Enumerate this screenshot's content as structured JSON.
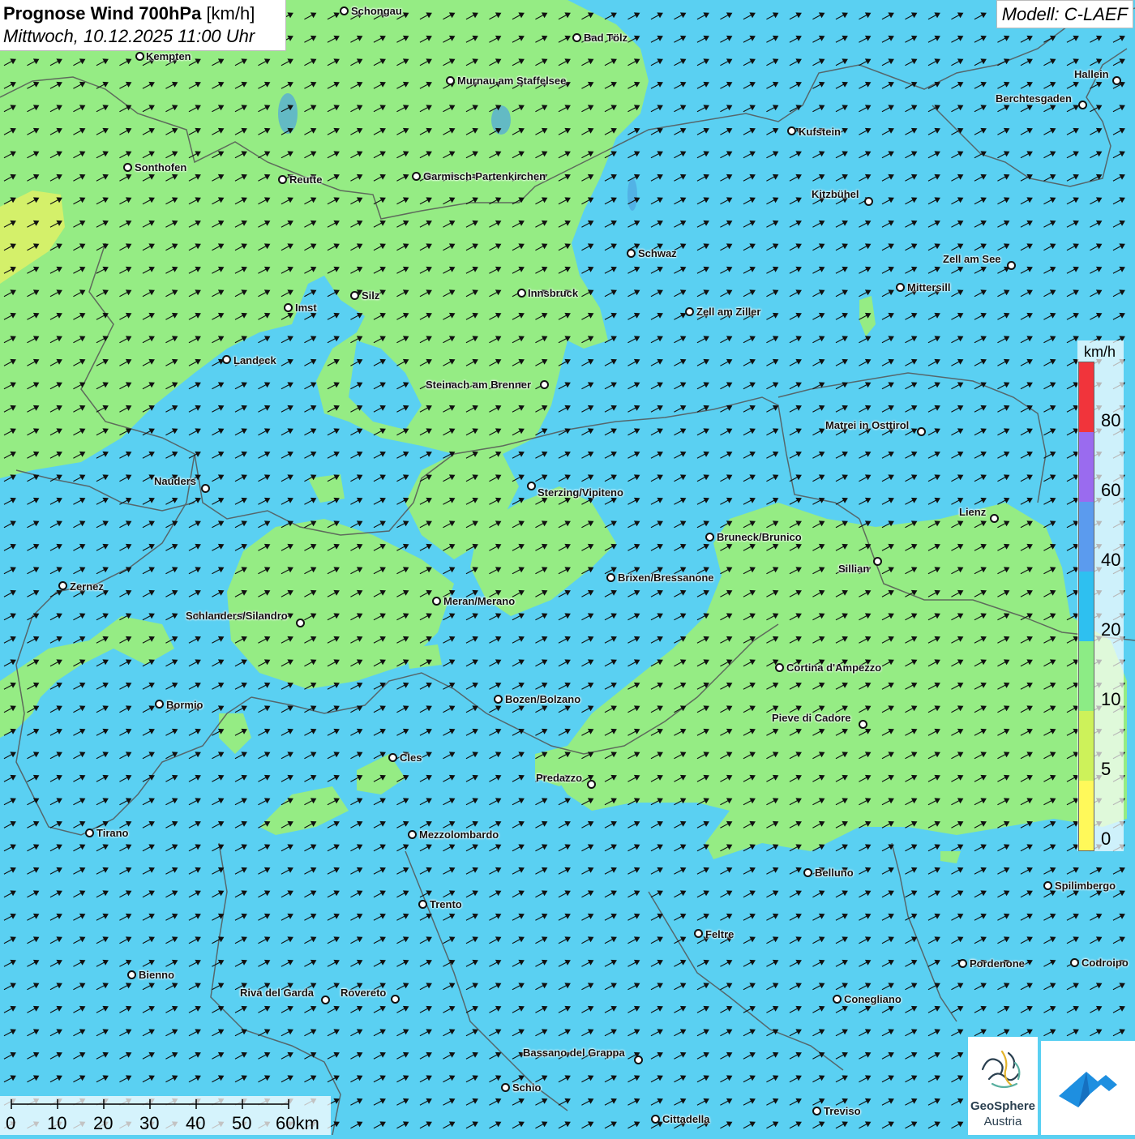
{
  "header": {
    "title_bold": "Prognose Wind 700hPa",
    "title_unit": "[km/h]",
    "subtitle": "Mittwoch, 10.12.2025 11:00 Uhr"
  },
  "model_label": "Modell: C-LAEF",
  "legend": {
    "unit": "km/h",
    "labels": [
      "80",
      "60",
      "40",
      "20",
      "10",
      "5",
      "0"
    ],
    "colors": {
      "0-5": "#fff95a",
      "5-10": "#cdf25a",
      "10-20": "#8cec85",
      "20-40": "#2ec0f0",
      "40-60": "#5b9bee",
      "60-80": "#9a6bef",
      "80+": "#f1343b"
    }
  },
  "map_colors": {
    "fill_light_blue": "#5ad0f2",
    "fill_green": "#95ec84",
    "fill_yellowgreen": "#d4f06a",
    "border": "#555555",
    "arrow": "#111111"
  },
  "wind_direction": "north-east",
  "scalebar": {
    "labels": [
      "0",
      "10",
      "20",
      "30",
      "40",
      "50",
      "60km"
    ]
  },
  "cities": [
    {
      "name": "Schongau"
    },
    {
      "name": "Bad Tölz"
    },
    {
      "name": "Kempten"
    },
    {
      "name": "Murnau am Staffelsee"
    },
    {
      "name": "Hallein"
    },
    {
      "name": "Berchtesgaden"
    },
    {
      "name": "Kufstein"
    },
    {
      "name": "Sonthofen"
    },
    {
      "name": "Reutte"
    },
    {
      "name": "Garmisch-Partenkirchen"
    },
    {
      "name": "Kitzbühel"
    },
    {
      "name": "Schwaz"
    },
    {
      "name": "Zell am See"
    },
    {
      "name": "Mittersill"
    },
    {
      "name": "Innsbruck"
    },
    {
      "name": "Silz"
    },
    {
      "name": "Imst"
    },
    {
      "name": "Zell am Ziller"
    },
    {
      "name": "Landeck"
    },
    {
      "name": "Steinach am Brenner"
    },
    {
      "name": "Matrei in Osttirol"
    },
    {
      "name": "Nauders"
    },
    {
      "name": "Sterzing/Vipiteno"
    },
    {
      "name": "Lienz"
    },
    {
      "name": "Bruneck/Brunico"
    },
    {
      "name": "Sillian"
    },
    {
      "name": "Brixen/Bressanone"
    },
    {
      "name": "Zernez"
    },
    {
      "name": "Meran/Merano"
    },
    {
      "name": "Schlanders/Silandro"
    },
    {
      "name": "Cortina d'Ampezzo"
    },
    {
      "name": "Bozen/Bolzano"
    },
    {
      "name": "Bormio"
    },
    {
      "name": "Pieve di Cadore"
    },
    {
      "name": "Cles"
    },
    {
      "name": "Predazzo"
    },
    {
      "name": "Tirano"
    },
    {
      "name": "Mezzolombardo"
    },
    {
      "name": "Belluno"
    },
    {
      "name": "Spilimbergo"
    },
    {
      "name": "Trento"
    },
    {
      "name": "Feltre"
    },
    {
      "name": "Pordenone"
    },
    {
      "name": "Codroipo"
    },
    {
      "name": "Bienno"
    },
    {
      "name": "Riva del Garda"
    },
    {
      "name": "Rovereto"
    },
    {
      "name": "Conegliano"
    },
    {
      "name": "Bassano del Grappa"
    },
    {
      "name": "Schio"
    },
    {
      "name": "Treviso"
    },
    {
      "name": "Cittadella"
    }
  ],
  "logos": {
    "geosphere_line1": "GeoSphere",
    "geosphere_line2": "Austria"
  }
}
